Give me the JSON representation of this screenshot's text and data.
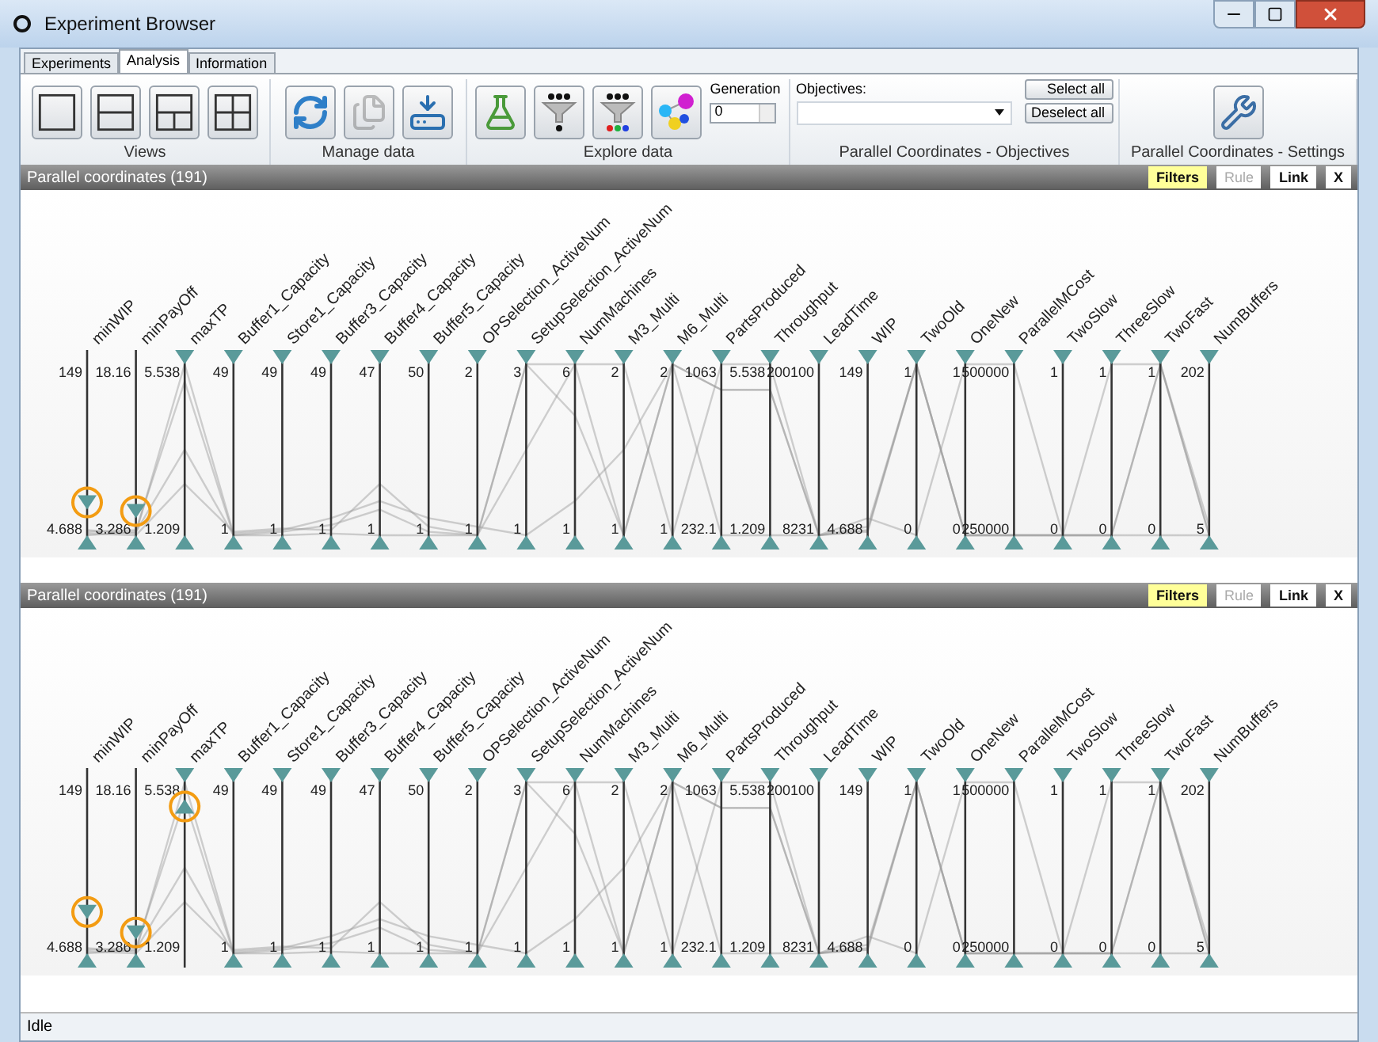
{
  "window": {
    "title": "Experiment Browser"
  },
  "tabs": [
    {
      "label": "Experiments",
      "selected": false
    },
    {
      "label": "Analysis",
      "selected": true
    },
    {
      "label": "Information",
      "selected": false
    }
  ],
  "ribbon": {
    "views": {
      "label": "Views",
      "buttons": [
        {
          "kind": "one-pane"
        },
        {
          "kind": "two-rows"
        },
        {
          "kind": "three-panes"
        },
        {
          "kind": "four-panes"
        }
      ]
    },
    "manage": {
      "label": "Manage data",
      "buttons": [
        {
          "kind": "refresh",
          "disabled": false
        },
        {
          "kind": "copy",
          "disabled": true
        },
        {
          "kind": "save",
          "disabled": false
        }
      ]
    },
    "explore": {
      "label": "Explore data",
      "buttons": [
        {
          "kind": "flask"
        },
        {
          "kind": "funnel"
        },
        {
          "kind": "funnel-colors"
        },
        {
          "kind": "network"
        }
      ],
      "generation": {
        "label": "Generation",
        "value": "0"
      }
    },
    "objectives": {
      "label": "Parallel Coordinates - Objectives",
      "field_label": "Objectives:",
      "buttons": [
        "Select all",
        "Deselect all"
      ]
    },
    "settings": {
      "label": "Parallel Coordinates - Settings"
    }
  },
  "panels": [
    {
      "title": "Parallel coordinates (191)",
      "toolbar": [
        {
          "label": "Filters",
          "selected": true,
          "disabled": false
        },
        {
          "label": "Rule",
          "selected": false,
          "disabled": true
        },
        {
          "label": "Link",
          "selected": false,
          "disabled": false
        },
        {
          "label": "X",
          "selected": false,
          "disabled": false
        }
      ],
      "axes": [
        {
          "name": "minWIP",
          "max": "149",
          "min": "4.688",
          "top_handle": {
            "level": 0.15,
            "circled": true
          },
          "bottom_handle": {
            "level": 0,
            "circled": false
          }
        },
        {
          "name": "minPayOff",
          "max": "18.16",
          "min": "3.286",
          "top_handle": {
            "level": 0.1,
            "circled": true
          },
          "bottom_handle": {
            "level": 0,
            "circled": false
          }
        },
        {
          "name": "maxTP",
          "max": "5.538",
          "min": "1.209",
          "top_handle": {
            "level": 1,
            "circled": false
          },
          "bottom_handle": {
            "level": 0,
            "circled": false
          }
        },
        {
          "name": "Buffer1_Capacity",
          "max": "49",
          "min": "1",
          "top_handle": {
            "level": 1,
            "circled": false
          },
          "bottom_handle": {
            "level": 0,
            "circled": false
          }
        },
        {
          "name": "Store1_Capacity",
          "max": "49",
          "min": "1",
          "top_handle": {
            "level": 1,
            "circled": false
          },
          "bottom_handle": {
            "level": 0,
            "circled": false
          }
        },
        {
          "name": "Buffer3_Capacity",
          "max": "49",
          "min": "1",
          "top_handle": {
            "level": 1,
            "circled": false
          },
          "bottom_handle": {
            "level": 0,
            "circled": false
          }
        },
        {
          "name": "Buffer4_Capacity",
          "max": "47",
          "min": "1",
          "top_handle": {
            "level": 1,
            "circled": false
          },
          "bottom_handle": {
            "level": 0,
            "circled": false
          }
        },
        {
          "name": "Buffer5_Capacity",
          "max": "50",
          "min": "1",
          "top_handle": {
            "level": 1,
            "circled": false
          },
          "bottom_handle": {
            "level": 0,
            "circled": false
          }
        },
        {
          "name": "OPSelection_ActiveNum",
          "max": "2",
          "min": "1",
          "top_handle": {
            "level": 1,
            "circled": false
          },
          "bottom_handle": {
            "level": 0,
            "circled": false
          }
        },
        {
          "name": "SetupSelection_ActiveNum",
          "max": "3",
          "min": "1",
          "top_handle": {
            "level": 1,
            "circled": false
          },
          "bottom_handle": {
            "level": 0,
            "circled": false
          }
        },
        {
          "name": "NumMachines",
          "max": "6",
          "min": "1",
          "top_handle": {
            "level": 1,
            "circled": false
          },
          "bottom_handle": {
            "level": 0,
            "circled": false
          }
        },
        {
          "name": "M3_Multi",
          "max": "2",
          "min": "1",
          "top_handle": {
            "level": 1,
            "circled": false
          },
          "bottom_handle": {
            "level": 0,
            "circled": false
          }
        },
        {
          "name": "M6_Multi",
          "max": "2",
          "min": "1",
          "top_handle": {
            "level": 1,
            "circled": false
          },
          "bottom_handle": {
            "level": 0,
            "circled": false
          }
        },
        {
          "name": "PartsProduced",
          "max": "1063",
          "min": "232.1",
          "top_handle": {
            "level": 1,
            "circled": false
          },
          "bottom_handle": {
            "level": 0,
            "circled": false
          }
        },
        {
          "name": "Throughput",
          "max": "5.538",
          "min": "1.209",
          "top_handle": {
            "level": 1,
            "circled": false
          },
          "bottom_handle": {
            "level": 0,
            "circled": false
          }
        },
        {
          "name": "LeadTime",
          "max": "200100",
          "min": "8231",
          "top_handle": {
            "level": 1,
            "circled": false
          },
          "bottom_handle": {
            "level": 0,
            "circled": false
          }
        },
        {
          "name": "WIP",
          "max": "149",
          "min": "4.688",
          "top_handle": {
            "level": 1,
            "circled": false
          },
          "bottom_handle": {
            "level": 0,
            "circled": false
          }
        },
        {
          "name": "TwoOld",
          "max": "1",
          "min": "0",
          "top_handle": {
            "level": 1,
            "circled": false
          },
          "bottom_handle": {
            "level": 0,
            "circled": false
          }
        },
        {
          "name": "OneNew",
          "max": "1",
          "min": "0",
          "top_handle": {
            "level": 1,
            "circled": false
          },
          "bottom_handle": {
            "level": 0,
            "circled": false
          }
        },
        {
          "name": "ParallelMCost",
          "max": "500000",
          "min": "250000",
          "top_handle": {
            "level": 1,
            "circled": false
          },
          "bottom_handle": {
            "level": 0,
            "circled": false
          }
        },
        {
          "name": "TwoSlow",
          "max": "1",
          "min": "0",
          "top_handle": {
            "level": 1,
            "circled": false
          },
          "bottom_handle": {
            "level": 0,
            "circled": false
          }
        },
        {
          "name": "ThreeSlow",
          "max": "1",
          "min": "0",
          "top_handle": {
            "level": 1,
            "circled": false
          },
          "bottom_handle": {
            "level": 0,
            "circled": false
          }
        },
        {
          "name": "TwoFast",
          "max": "1",
          "min": "0",
          "top_handle": {
            "level": 1,
            "circled": false
          },
          "bottom_handle": {
            "level": 0,
            "circled": false
          }
        },
        {
          "name": "NumBuffers",
          "max": "202",
          "min": "5",
          "top_handle": {
            "level": 1,
            "circled": false
          },
          "bottom_handle": {
            "level": 0,
            "circled": false
          }
        }
      ]
    },
    {
      "title": "Parallel coordinates (191)",
      "toolbar": [
        {
          "label": "Filters",
          "selected": true,
          "disabled": false
        },
        {
          "label": "Rule",
          "selected": false,
          "disabled": true
        },
        {
          "label": "Link",
          "selected": false,
          "disabled": false
        },
        {
          "label": "X",
          "selected": false,
          "disabled": false
        }
      ],
      "axes": [
        {
          "name": "minWIP",
          "max": "149",
          "min": "4.688",
          "top_handle": {
            "level": 0.2,
            "circled": true
          },
          "bottom_handle": {
            "level": 0,
            "circled": false
          }
        },
        {
          "name": "minPayOff",
          "max": "18.16",
          "min": "3.286",
          "top_handle": {
            "level": 0.08,
            "circled": true
          },
          "bottom_handle": {
            "level": 0,
            "circled": false
          }
        },
        {
          "name": "maxTP",
          "max": "5.538",
          "min": "1.209",
          "top_handle": {
            "level": 1,
            "circled": false
          },
          "bottom_handle": {
            "level": 0.9,
            "circled": true
          }
        },
        {
          "name": "Buffer1_Capacity",
          "max": "49",
          "min": "1",
          "top_handle": {
            "level": 1,
            "circled": false
          },
          "bottom_handle": {
            "level": 0,
            "circled": false
          }
        },
        {
          "name": "Store1_Capacity",
          "max": "49",
          "min": "1",
          "top_handle": {
            "level": 1,
            "circled": false
          },
          "bottom_handle": {
            "level": 0,
            "circled": false
          }
        },
        {
          "name": "Buffer3_Capacity",
          "max": "49",
          "min": "1",
          "top_handle": {
            "level": 1,
            "circled": false
          },
          "bottom_handle": {
            "level": 0,
            "circled": false
          }
        },
        {
          "name": "Buffer4_Capacity",
          "max": "47",
          "min": "1",
          "top_handle": {
            "level": 1,
            "circled": false
          },
          "bottom_handle": {
            "level": 0,
            "circled": false
          }
        },
        {
          "name": "Buffer5_Capacity",
          "max": "50",
          "min": "1",
          "top_handle": {
            "level": 1,
            "circled": false
          },
          "bottom_handle": {
            "level": 0,
            "circled": false
          }
        },
        {
          "name": "OPSelection_ActiveNum",
          "max": "2",
          "min": "1",
          "top_handle": {
            "level": 1,
            "circled": false
          },
          "bottom_handle": {
            "level": 0,
            "circled": false
          }
        },
        {
          "name": "SetupSelection_ActiveNum",
          "max": "3",
          "min": "1",
          "top_handle": {
            "level": 1,
            "circled": false
          },
          "bottom_handle": {
            "level": 0,
            "circled": false
          }
        },
        {
          "name": "NumMachines",
          "max": "6",
          "min": "1",
          "top_handle": {
            "level": 1,
            "circled": false
          },
          "bottom_handle": {
            "level": 0,
            "circled": false
          }
        },
        {
          "name": "M3_Multi",
          "max": "2",
          "min": "1",
          "top_handle": {
            "level": 1,
            "circled": false
          },
          "bottom_handle": {
            "level": 0,
            "circled": false
          }
        },
        {
          "name": "M6_Multi",
          "max": "2",
          "min": "1",
          "top_handle": {
            "level": 1,
            "circled": false
          },
          "bottom_handle": {
            "level": 0,
            "circled": false
          }
        },
        {
          "name": "PartsProduced",
          "max": "1063",
          "min": "232.1",
          "top_handle": {
            "level": 1,
            "circled": false
          },
          "bottom_handle": {
            "level": 0,
            "circled": false
          }
        },
        {
          "name": "Throughput",
          "max": "5.538",
          "min": "1.209",
          "top_handle": {
            "level": 1,
            "circled": false
          },
          "bottom_handle": {
            "level": 0,
            "circled": false
          }
        },
        {
          "name": "LeadTime",
          "max": "200100",
          "min": "8231",
          "top_handle": {
            "level": 1,
            "circled": false
          },
          "bottom_handle": {
            "level": 0,
            "circled": false
          }
        },
        {
          "name": "WIP",
          "max": "149",
          "min": "4.688",
          "top_handle": {
            "level": 1,
            "circled": false
          },
          "bottom_handle": {
            "level": 0,
            "circled": false
          }
        },
        {
          "name": "TwoOld",
          "max": "1",
          "min": "0",
          "top_handle": {
            "level": 1,
            "circled": false
          },
          "bottom_handle": {
            "level": 0,
            "circled": false
          }
        },
        {
          "name": "OneNew",
          "max": "1",
          "min": "0",
          "top_handle": {
            "level": 1,
            "circled": false
          },
          "bottom_handle": {
            "level": 0,
            "circled": false
          }
        },
        {
          "name": "ParallelMCost",
          "max": "500000",
          "min": "250000",
          "top_handle": {
            "level": 1,
            "circled": false
          },
          "bottom_handle": {
            "level": 0,
            "circled": false
          }
        },
        {
          "name": "TwoSlow",
          "max": "1",
          "min": "0",
          "top_handle": {
            "level": 1,
            "circled": false
          },
          "bottom_handle": {
            "level": 0,
            "circled": false
          }
        },
        {
          "name": "ThreeSlow",
          "max": "1",
          "min": "0",
          "top_handle": {
            "level": 1,
            "circled": false
          },
          "bottom_handle": {
            "level": 0,
            "circled": false
          }
        },
        {
          "name": "TwoFast",
          "max": "1",
          "min": "0",
          "top_handle": {
            "level": 1,
            "circled": false
          },
          "bottom_handle": {
            "level": 0,
            "circled": false
          }
        },
        {
          "name": "NumBuffers",
          "max": "202",
          "min": "5",
          "top_handle": {
            "level": 1,
            "circled": false
          },
          "bottom_handle": {
            "level": 0,
            "circled": false
          }
        }
      ]
    }
  ],
  "status_bar": {
    "text": "Idle"
  }
}
